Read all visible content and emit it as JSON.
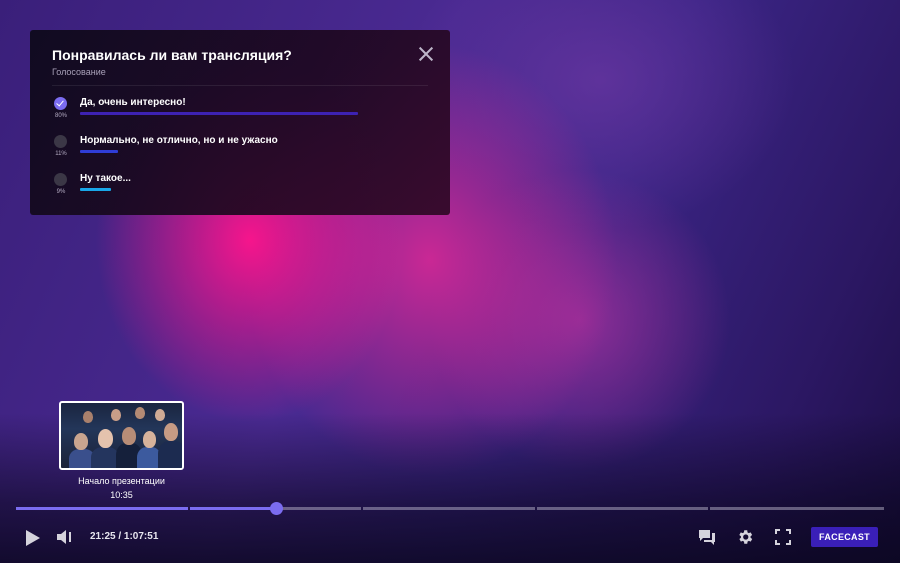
{
  "poll": {
    "title": "Понравилась ли вам трансляция?",
    "subtitle": "Голосование",
    "options": [
      {
        "label": "Да, очень интересно!",
        "percent": "80%",
        "fraction": 0.8,
        "selected": true,
        "bar_color": "#3d22b3"
      },
      {
        "label": "Нормально, не отлично, но и не ужасно",
        "percent": "11%",
        "fraction": 0.11,
        "selected": false,
        "bar_color": "#2f3dd6"
      },
      {
        "label": "Ну такое...",
        "percent": "9%",
        "fraction": 0.09,
        "selected": false,
        "bar_color": "#19a7e8"
      }
    ]
  },
  "preview": {
    "title": "Начало презентации",
    "time": "10:35"
  },
  "player": {
    "time_display": "21:25 / 1:07:51",
    "progress_fraction": 0.3,
    "chapter_boundaries": [
      0.2,
      0.4,
      0.6,
      0.8
    ],
    "accent_color": "#7b6cf0",
    "brand_label": "FACECAST",
    "brand_color": "#3a1fb8"
  }
}
